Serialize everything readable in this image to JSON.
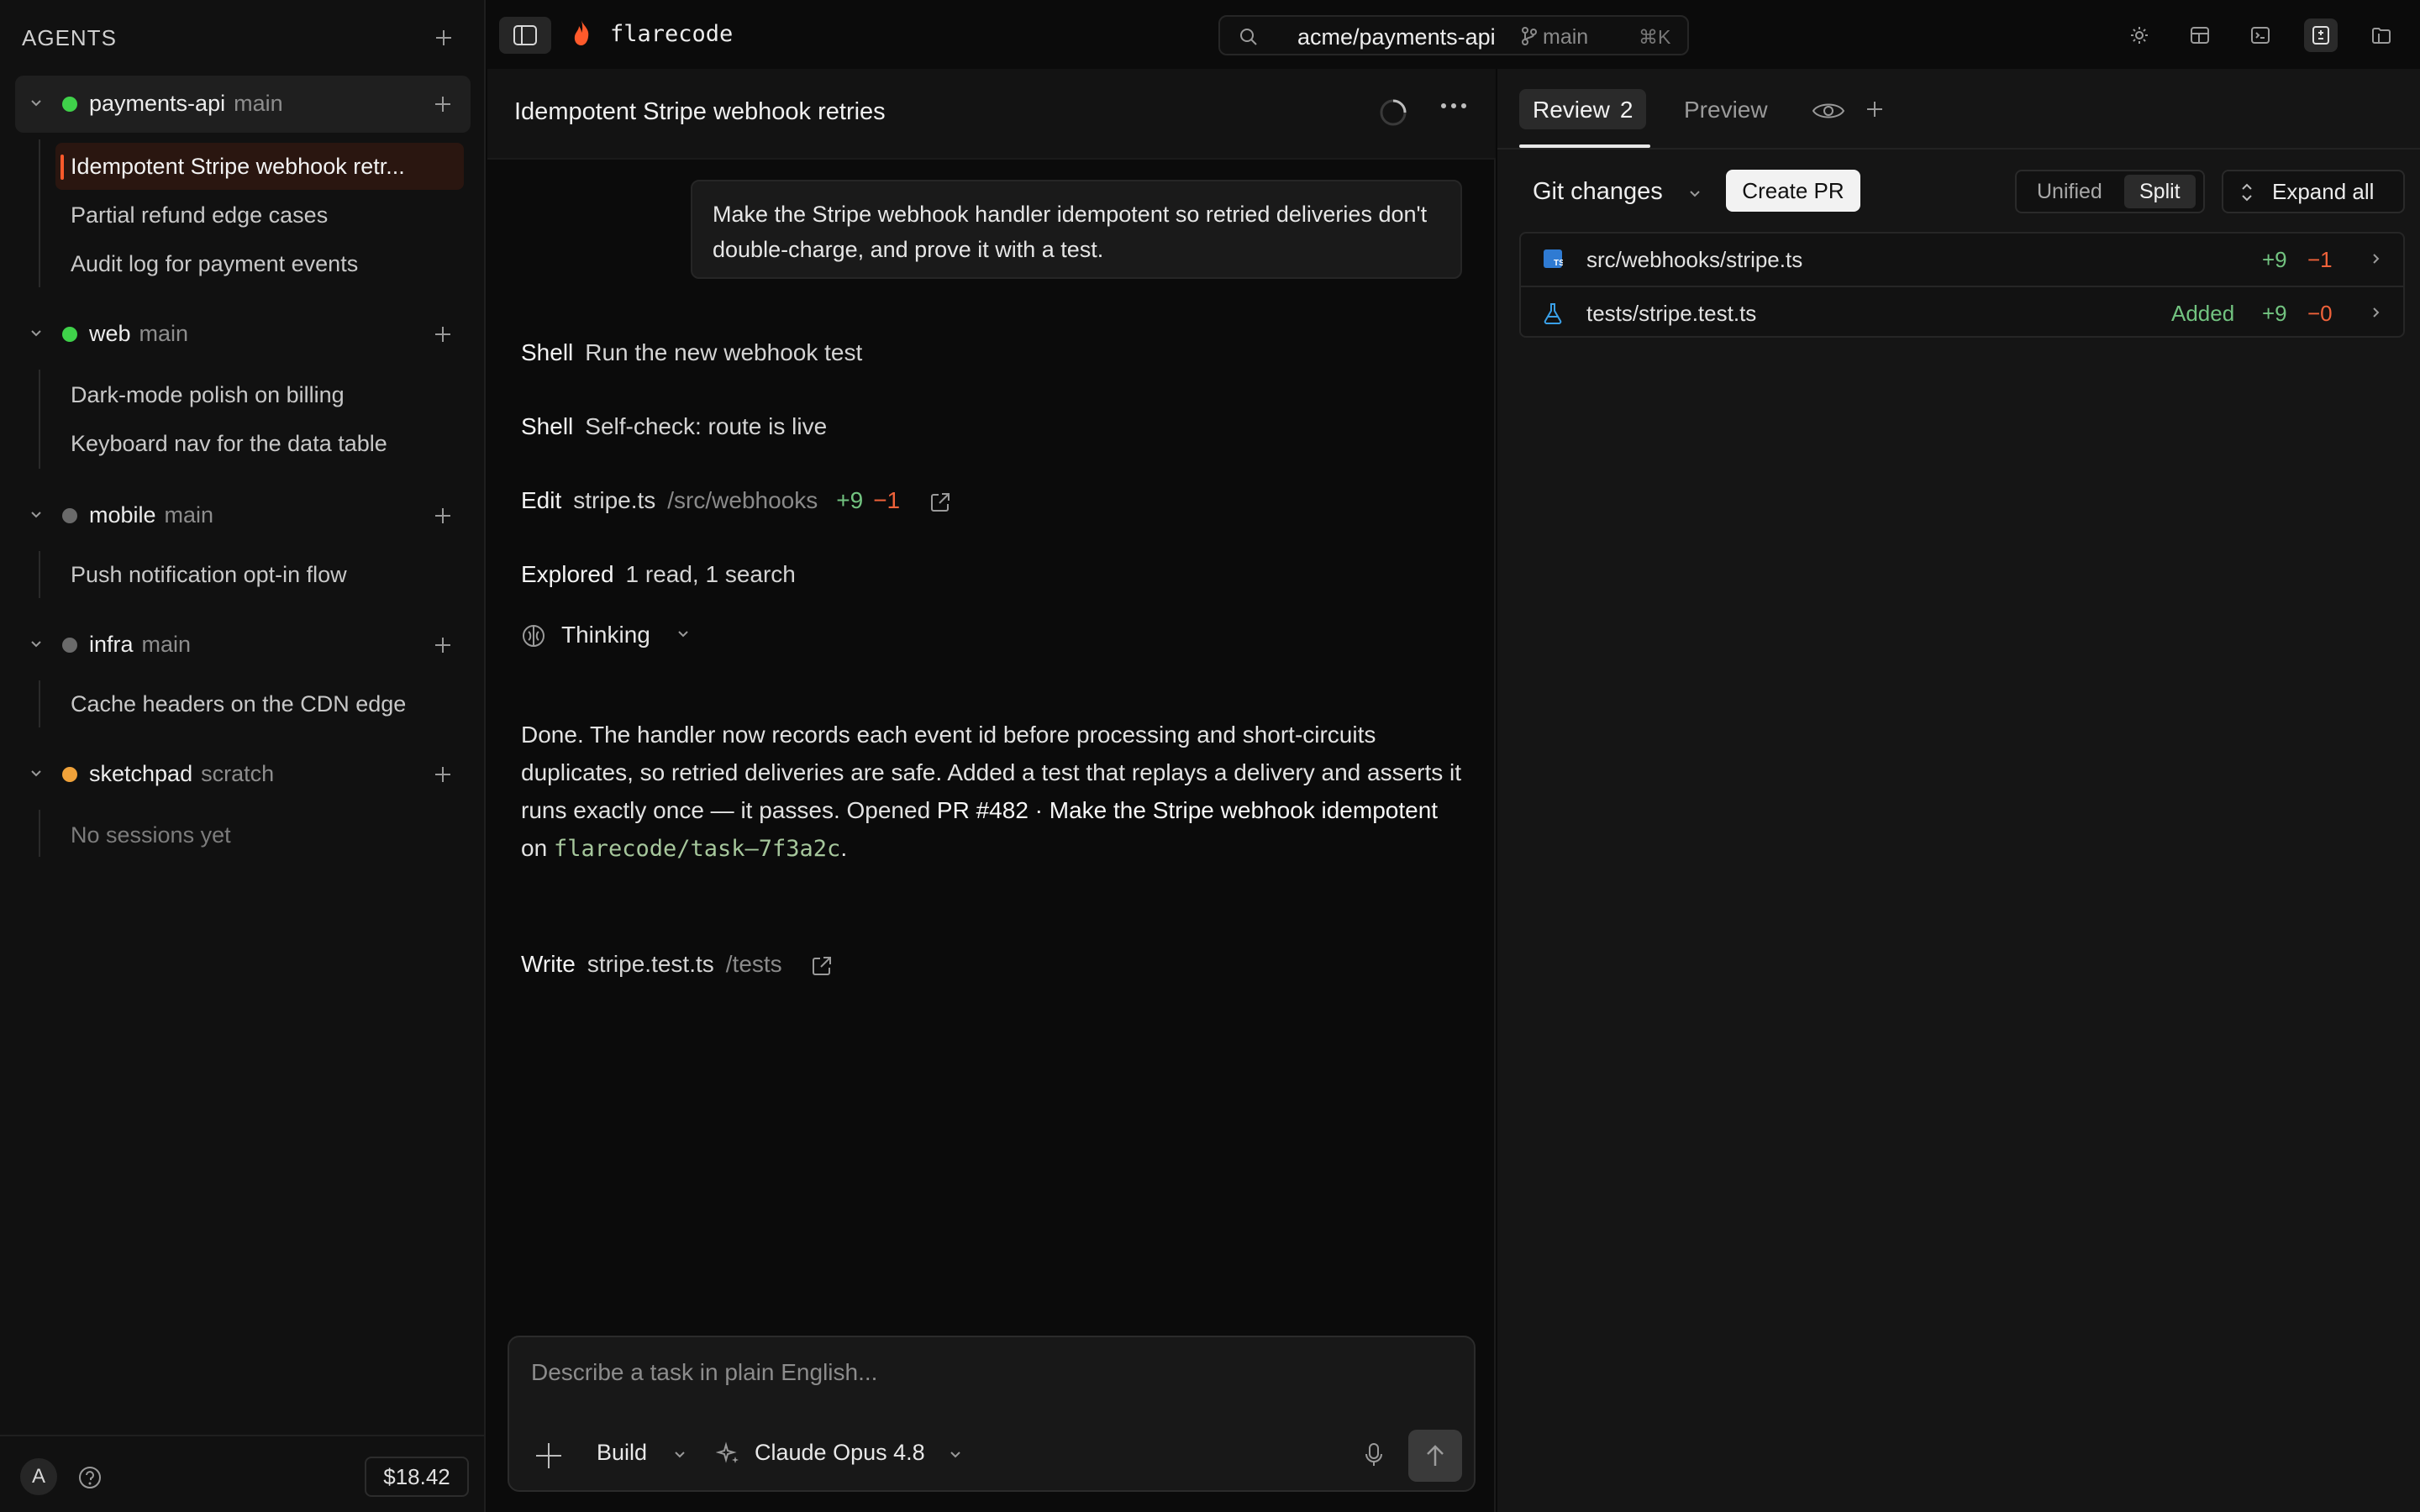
{
  "sidebar": {
    "title": "AGENTS",
    "projects": [
      {
        "name": "payments-api",
        "branch": "main",
        "status_color": "#3fd14a",
        "sessions": [
          "Idempotent Stripe webhook retr...",
          "Partial refund edge cases",
          "Audit log for payment events"
        ]
      },
      {
        "name": "web",
        "branch": "main",
        "status_color": "#3fd14a",
        "sessions": [
          "Dark-mode polish on billing",
          "Keyboard nav for the data table"
        ]
      },
      {
        "name": "mobile",
        "branch": "main",
        "status_color": "#6a6a6a",
        "sessions": [
          "Push notification opt-in flow"
        ]
      },
      {
        "name": "infra",
        "branch": "main",
        "status_color": "#6a6a6a",
        "sessions": [
          "Cache headers on the CDN edge"
        ]
      },
      {
        "name": "sketchpad",
        "branch": "scratch",
        "status_color": "#f0a23a",
        "sessions": [
          "No sessions yet"
        ]
      }
    ],
    "footer": {
      "avatar": "A",
      "cost": "$18.42"
    }
  },
  "topbar": {
    "app_name": "flarecode",
    "repo": "acme/payments-api",
    "branch": "main",
    "shortcut": "⌘K",
    "accent": "#ff5a2b"
  },
  "chat": {
    "title": "Idempotent Stripe webhook retries",
    "user_message": "Make the Stripe webhook handler idempotent so retried deliveries don't double-charge, and prove it with a test.",
    "tools": [
      {
        "kind": "Shell",
        "text": "Run the new webhook test"
      },
      {
        "kind": "Shell",
        "text": "Self-check: route is live"
      },
      {
        "kind": "Edit",
        "file": "stripe.ts",
        "path": "/src/webhooks",
        "add": "+9",
        "del": "−1"
      },
      {
        "kind": "Explored",
        "text": "1 read, 1 search"
      }
    ],
    "thinking": "Thinking",
    "answer": {
      "p1": "Done. The handler now records each event id before processing and short-circuits duplicates, so retried deliveries are safe. Added a test that replays a delivery and asserts it runs exactly once — it passes. Opened ",
      "pr": "PR #482 · Make the Stripe webhook idempotent",
      "on": " on ",
      "branch": "flarecode/task–7f3a2c",
      "end": "."
    },
    "write": {
      "kind": "Write",
      "file": "stripe.test.ts",
      "path": "/tests"
    },
    "composer": {
      "placeholder": "Describe a task in plain English...",
      "mode": "Build",
      "model": "Claude Opus 4.8"
    }
  },
  "review": {
    "tabs": [
      {
        "label": "Review",
        "count": "2"
      },
      {
        "label": "Preview"
      }
    ],
    "git_label": "Git changes",
    "create_pr": "Create PR",
    "view_modes": [
      "Unified",
      "Split"
    ],
    "expand": "Expand all",
    "files": [
      {
        "name": "src/webhooks/stripe.ts",
        "status": "",
        "add": "+9",
        "del": "−1"
      },
      {
        "name": "tests/stripe.test.ts",
        "status": "Added",
        "add": "+9",
        "del": "−0"
      }
    ]
  }
}
